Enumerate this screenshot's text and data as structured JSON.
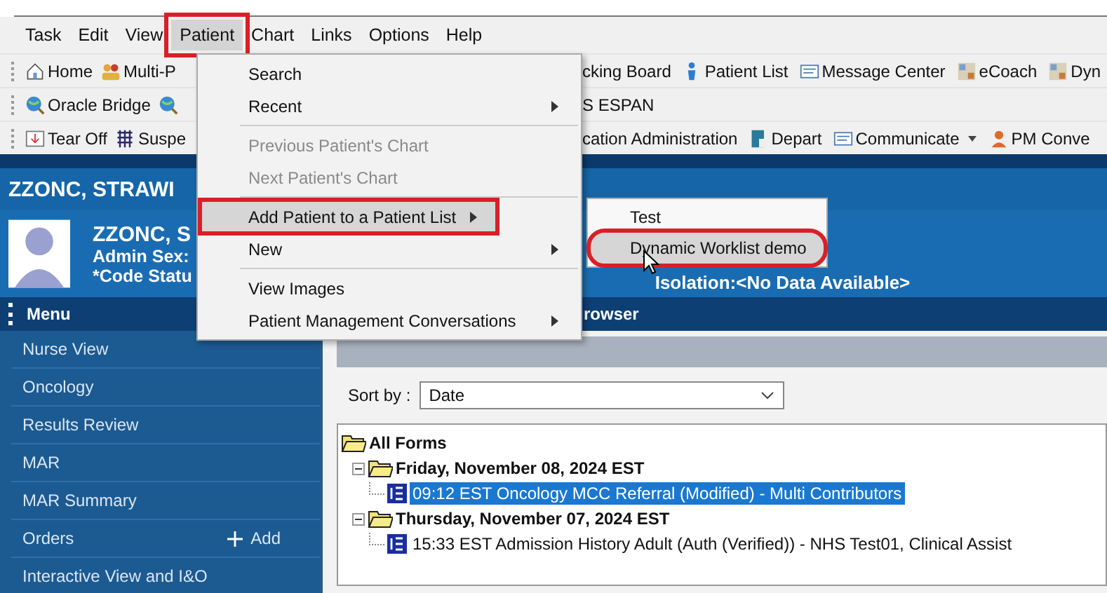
{
  "menu_bar": [
    {
      "label": "Task",
      "selected": false,
      "highlighted": false
    },
    {
      "label": "Edit",
      "selected": false,
      "highlighted": false
    },
    {
      "label": "View",
      "selected": false,
      "highlighted": false
    },
    {
      "label": "Patient",
      "selected": true,
      "highlighted": true
    },
    {
      "label": "Chart",
      "selected": false,
      "highlighted": false
    },
    {
      "label": "Links",
      "selected": false,
      "highlighted": false
    },
    {
      "label": "Options",
      "selected": false,
      "highlighted": false
    },
    {
      "label": "Help",
      "selected": false,
      "highlighted": false
    }
  ],
  "toolbar_rows": [
    {
      "left": [
        {
          "label": "Home"
        },
        {
          "label": "Multi-P"
        }
      ],
      "right": [
        {
          "label": "cking Board"
        },
        {
          "label": "Patient List"
        },
        {
          "label": "Message Center"
        },
        {
          "label": "eCoach"
        },
        {
          "label": "Dyn"
        }
      ]
    },
    {
      "left": [
        {
          "label": "Oracle Bridge"
        }
      ],
      "right": [
        {
          "label": "S ESPAN"
        }
      ]
    },
    {
      "left": [
        {
          "label": "Tear Off"
        },
        {
          "label": "Suspe"
        }
      ],
      "right": [
        {
          "label": "cation Administration"
        },
        {
          "label": "Depart"
        },
        {
          "label": "Communicate"
        },
        {
          "label": "PM Conve"
        }
      ]
    }
  ],
  "banner": {
    "title": "ZZONC, STRAWI"
  },
  "patient": {
    "name": "ZZONC, S",
    "lines": [
      "Admin Sex:",
      "*Code Statu"
    ],
    "isolation": "Isolation:<No Data Available>"
  },
  "menu_header": {
    "label": "Menu"
  },
  "sidebar": {
    "items": [
      {
        "label": "Nurse View"
      },
      {
        "label": "Oncology"
      },
      {
        "label": "Results Review"
      },
      {
        "label": "MAR"
      },
      {
        "label": "MAR Summary"
      },
      {
        "label": "Orders",
        "action": "Add"
      },
      {
        "label": "Interactive View and I&O"
      }
    ]
  },
  "content": {
    "title": "rowser",
    "sort": {
      "label": "Sort by :",
      "value": "Date"
    },
    "tree": [
      {
        "label": "All Forms",
        "kind": "folder",
        "children": [
          {
            "label": "Friday, November 08, 2024 EST",
            "kind": "folder",
            "children": [
              {
                "label": "09:12 EST Oncology MCC Referral (Modified) - Multi Contributors",
                "kind": "form",
                "selected": true
              }
            ]
          },
          {
            "label": "Thursday, November 07, 2024 EST",
            "kind": "folder",
            "children": [
              {
                "label": "15:33 EST Admission History Adult (Auth (Verified)) - NHS Test01, Clinical Assist",
                "kind": "form",
                "selected": false
              }
            ]
          }
        ]
      }
    ]
  },
  "patient_menu": {
    "items": [
      {
        "kind": "item",
        "label": "Search",
        "disabled": false,
        "submenu": false,
        "selected": false,
        "highlighted": false
      },
      {
        "kind": "item",
        "label": "Recent",
        "disabled": false,
        "submenu": true,
        "selected": false,
        "highlighted": false
      },
      {
        "kind": "separator"
      },
      {
        "kind": "item",
        "label": "Previous Patient's Chart",
        "disabled": true,
        "submenu": false,
        "selected": false,
        "highlighted": false
      },
      {
        "kind": "item",
        "label": "Next Patient's Chart",
        "disabled": true,
        "submenu": false,
        "selected": false,
        "highlighted": false
      },
      {
        "kind": "separator"
      },
      {
        "kind": "item",
        "label": "Add Patient to a Patient List",
        "disabled": false,
        "submenu": true,
        "selected": true,
        "highlighted": true
      },
      {
        "kind": "item",
        "label": "New",
        "disabled": false,
        "submenu": true,
        "selected": false,
        "highlighted": false
      },
      {
        "kind": "separator"
      },
      {
        "kind": "item",
        "label": "View Images",
        "disabled": false,
        "submenu": false,
        "selected": false,
        "highlighted": false
      },
      {
        "kind": "item",
        "label": "Patient Management Conversations",
        "disabled": false,
        "submenu": true,
        "selected": false,
        "highlighted": false
      }
    ]
  },
  "submenu": {
    "items": [
      {
        "label": "Test",
        "selected": false,
        "highlighted": false
      },
      {
        "label": "Dynamic Worklist demo",
        "selected": true,
        "highlighted": true
      }
    ]
  }
}
